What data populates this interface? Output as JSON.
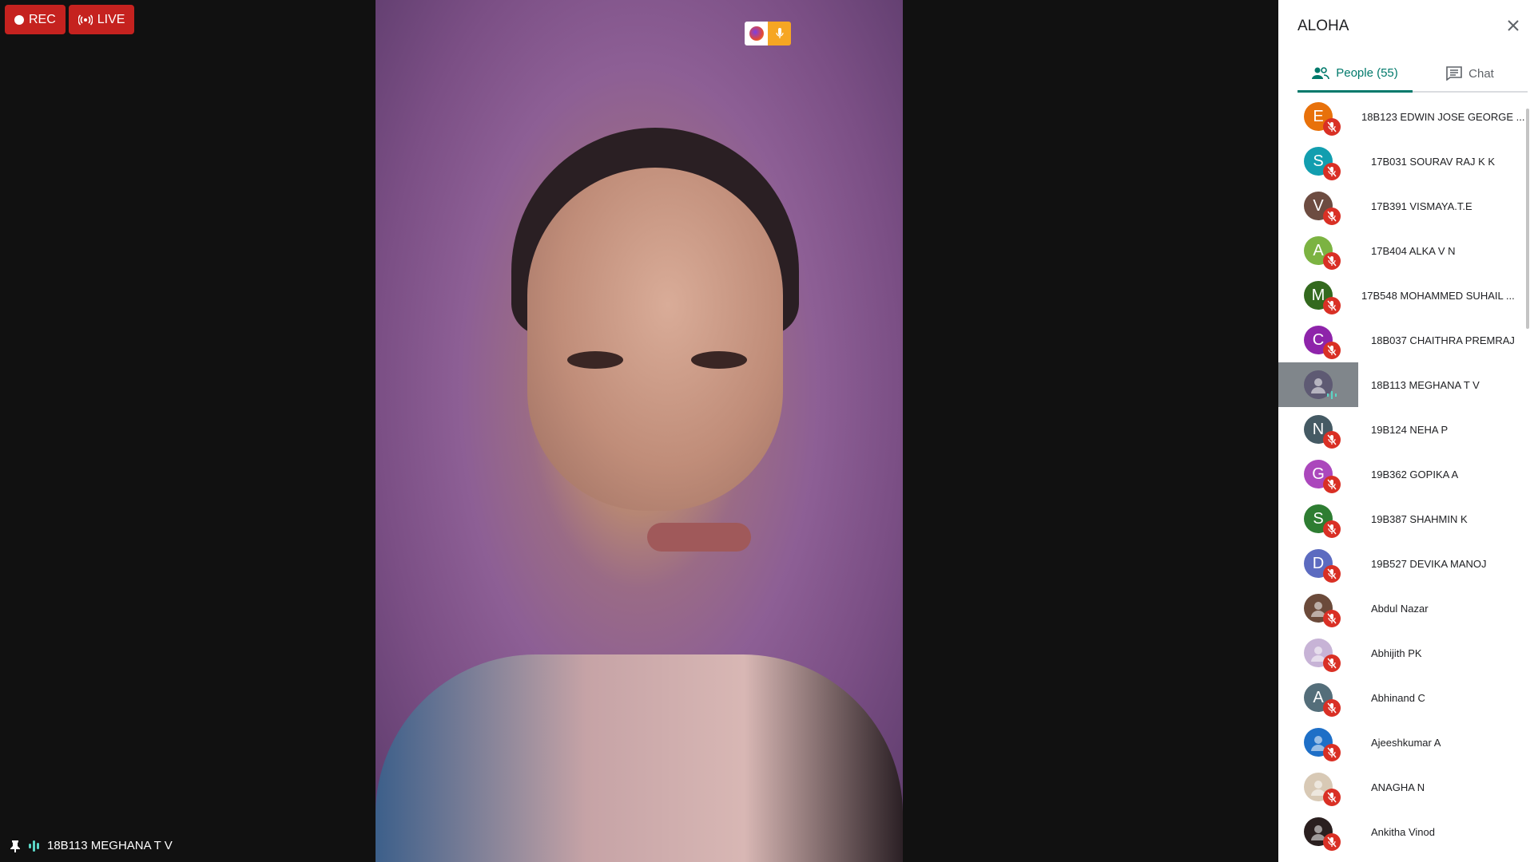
{
  "badges": {
    "rec": "REC",
    "live": "LIVE"
  },
  "speaker": {
    "name": "18B113 MEGHANA T V"
  },
  "panel": {
    "title": "ALOHA",
    "tabs": [
      {
        "label": "People (55)",
        "icon": "people-icon",
        "active": true
      },
      {
        "label": "Chat",
        "icon": "chat-icon",
        "active": false
      }
    ],
    "participants": [
      {
        "initial": "E",
        "color": "#e8710a",
        "name": "18B123 EDWIN JOSE GEORGE ..."
      },
      {
        "initial": "S",
        "color": "#129eaf",
        "name": "17B031 SOURAV RAJ K K"
      },
      {
        "initial": "V",
        "color": "#6d4c41",
        "name": "17B391 VISMAYA.T.E"
      },
      {
        "initial": "A",
        "color": "#7cb342",
        "name": "17B404 ALKA V N"
      },
      {
        "initial": "M",
        "color": "#33691e",
        "name": "17B548 MOHAMMED SUHAIL ..."
      },
      {
        "initial": "C",
        "color": "#8e24aa",
        "name": "18B037 CHAITHRA PREMRAJ"
      },
      {
        "initial": "",
        "color": "#5e5a73",
        "name": "18B113 MEGHANA T V"
      },
      {
        "initial": "N",
        "color": "#455a64",
        "name": "19B124 NEHA P"
      },
      {
        "initial": "G",
        "color": "#ab47bc",
        "name": "19B362 GOPIKA A"
      },
      {
        "initial": "S",
        "color": "#2e7d32",
        "name": "19B387 SHAHMIN K"
      },
      {
        "initial": "D",
        "color": "#5c6bc0",
        "name": "19B527 DEVIKA MANOJ"
      },
      {
        "initial": "",
        "color": "#6b4a3a",
        "name": "Abdul Nazar"
      },
      {
        "initial": "",
        "color": "#c7b3d6",
        "name": "Abhijith PK"
      },
      {
        "initial": "A",
        "color": "#546e7a",
        "name": "Abhinand C"
      },
      {
        "initial": "",
        "color": "#1e6fc7",
        "name": "Ajeeshkumar A"
      },
      {
        "initial": "",
        "color": "#d8c9b5",
        "name": "ANAGHA N"
      },
      {
        "initial": "",
        "color": "#2a1f1f",
        "name": "Ankitha Vinod"
      }
    ]
  }
}
